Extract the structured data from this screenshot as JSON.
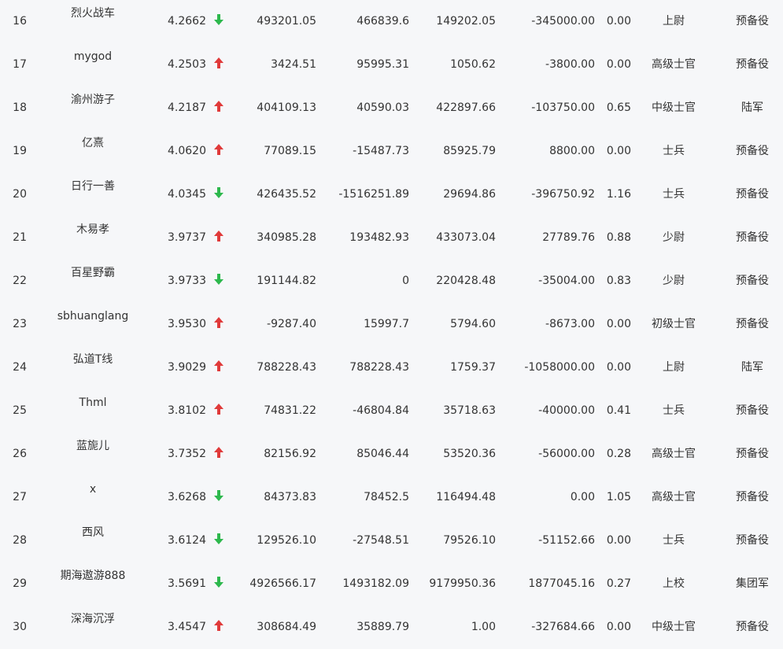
{
  "colors": {
    "background": "#f6f7f9",
    "text": "#333333",
    "up": "#e03a3a",
    "down": "#2db84d"
  },
  "icons": {
    "up": "arrow-up-icon",
    "down": "arrow-down-icon"
  },
  "rows": [
    {
      "rank": "16",
      "name": "烈火战车",
      "score": "4.2662",
      "trend": "down",
      "c1": "493201.05",
      "c2": "466839.6",
      "c3": "149202.05",
      "c4": "-345000.00",
      "c5": "0.00",
      "rank_title": "上尉",
      "branch": "预备役"
    },
    {
      "rank": "17",
      "name": "mygod",
      "score": "4.2503",
      "trend": "up",
      "c1": "3424.51",
      "c2": "95995.31",
      "c3": "1050.62",
      "c4": "-3800.00",
      "c5": "0.00",
      "rank_title": "高级士官",
      "branch": "预备役"
    },
    {
      "rank": "18",
      "name": "渝州游子",
      "score": "4.2187",
      "trend": "up",
      "c1": "404109.13",
      "c2": "40590.03",
      "c3": "422897.66",
      "c4": "-103750.00",
      "c5": "0.65",
      "rank_title": "中级士官",
      "branch": "陆军"
    },
    {
      "rank": "19",
      "name": "亿熹",
      "score": "4.0620",
      "trend": "up",
      "c1": "77089.15",
      "c2": "-15487.73",
      "c3": "85925.79",
      "c4": "8800.00",
      "c5": "0.00",
      "rank_title": "士兵",
      "branch": "预备役"
    },
    {
      "rank": "20",
      "name": "日行一善",
      "score": "4.0345",
      "trend": "down",
      "c1": "426435.52",
      "c2": "-1516251.89",
      "c3": "29694.86",
      "c4": "-396750.92",
      "c5": "1.16",
      "rank_title": "士兵",
      "branch": "预备役"
    },
    {
      "rank": "21",
      "name": "木易孝",
      "score": "3.9737",
      "trend": "up",
      "c1": "340985.28",
      "c2": "193482.93",
      "c3": "433073.04",
      "c4": "27789.76",
      "c5": "0.88",
      "rank_title": "少尉",
      "branch": "预备役"
    },
    {
      "rank": "22",
      "name": "百星野霸",
      "score": "3.9733",
      "trend": "down",
      "c1": "191144.82",
      "c2": "0",
      "c3": "220428.48",
      "c4": "-35004.00",
      "c5": "0.83",
      "rank_title": "少尉",
      "branch": "预备役"
    },
    {
      "rank": "23",
      "name": "sbhuanglang",
      "score": "3.9530",
      "trend": "up",
      "c1": "-9287.40",
      "c2": "15997.7",
      "c3": "5794.60",
      "c4": "-8673.00",
      "c5": "0.00",
      "rank_title": "初级士官",
      "branch": "预备役"
    },
    {
      "rank": "24",
      "name": "弘道T线",
      "score": "3.9029",
      "trend": "up",
      "c1": "788228.43",
      "c2": "788228.43",
      "c3": "1759.37",
      "c4": "-1058000.00",
      "c5": "0.00",
      "rank_title": "上尉",
      "branch": "陆军"
    },
    {
      "rank": "25",
      "name": "Thml",
      "score": "3.8102",
      "trend": "up",
      "c1": "74831.22",
      "c2": "-46804.84",
      "c3": "35718.63",
      "c4": "-40000.00",
      "c5": "0.41",
      "rank_title": "士兵",
      "branch": "预备役"
    },
    {
      "rank": "26",
      "name": "蓝旎儿",
      "score": "3.7352",
      "trend": "up",
      "c1": "82156.92",
      "c2": "85046.44",
      "c3": "53520.36",
      "c4": "-56000.00",
      "c5": "0.28",
      "rank_title": "高级士官",
      "branch": "预备役"
    },
    {
      "rank": "27",
      "name": "x",
      "score": "3.6268",
      "trend": "down",
      "c1": "84373.83",
      "c2": "78452.5",
      "c3": "116494.48",
      "c4": "0.00",
      "c5": "1.05",
      "rank_title": "高级士官",
      "branch": "预备役"
    },
    {
      "rank": "28",
      "name": "西风",
      "score": "3.6124",
      "trend": "down",
      "c1": "129526.10",
      "c2": "-27548.51",
      "c3": "79526.10",
      "c4": "-51152.66",
      "c5": "0.00",
      "rank_title": "士兵",
      "branch": "预备役"
    },
    {
      "rank": "29",
      "name": "期海遨游888",
      "score": "3.5691",
      "trend": "down",
      "c1": "4926566.17",
      "c2": "1493182.09",
      "c3": "9179950.36",
      "c4": "1877045.16",
      "c5": "0.27",
      "rank_title": "上校",
      "branch": "集团军"
    },
    {
      "rank": "30",
      "name": "深海沉浮",
      "score": "3.4547",
      "trend": "up",
      "c1": "308684.49",
      "c2": "35889.79",
      "c3": "1.00",
      "c4": "-327684.66",
      "c5": "0.00",
      "rank_title": "中级士官",
      "branch": "预备役"
    }
  ]
}
